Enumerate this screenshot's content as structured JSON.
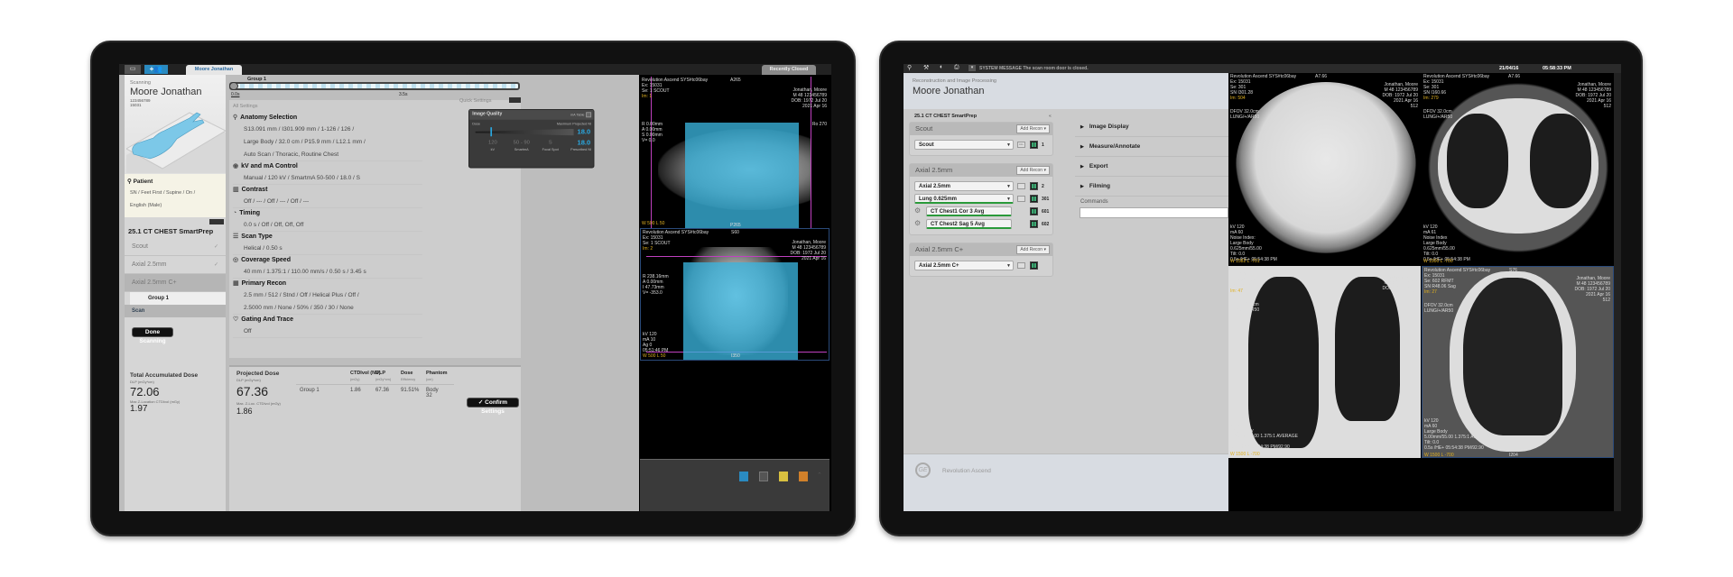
{
  "left_console": {
    "tabs": {
      "patient_tab": "Moore  Jonathan",
      "recently_closed": "Recently Closed"
    },
    "patient_panel": {
      "status": "Scanning",
      "name": "Moore  Jonathan",
      "id": "123456789",
      "exam": "15031",
      "patient_label": "Patient",
      "patient_line1": "SN / Feet First / Supine / On /",
      "patient_line2": "English (Male)"
    },
    "protocol": {
      "title": "25.1 CT CHEST SmartPrep",
      "items": [
        {
          "label": "Scout",
          "done": true
        },
        {
          "label": "Axial 2.5mm",
          "done": true
        },
        {
          "label": "Axial 2.5mm C+",
          "done": false
        }
      ],
      "group": "Group 1",
      "scan": "Scan"
    },
    "done_scanning": "Done Scanning",
    "timeline": {
      "group": "Group 1",
      "total_scan_time": "Total Scan Time: 3.5s",
      "start": "0.0s",
      "end": "3.5s"
    },
    "all_settings": {
      "title": "All Settings",
      "sections": [
        {
          "icon": "anatomy-icon",
          "title": "Anatomy Selection",
          "lines": [
            "S13.091 mm / I301.909 mm / 1-126 / 126 /",
            "Large Body / 32.0 cm / P15.9 mm / L12.1 mm /",
            "Auto Scan / Thoracic, Routine Chest"
          ]
        },
        {
          "icon": "kv-icon",
          "title": "kV and mA Control",
          "lines": [
            "Manual / 120 kV / SmartmA 50-500 / 18.0 / S"
          ]
        },
        {
          "icon": "contrast-icon",
          "title": "Contrast",
          "lines": [
            "Off / --- / Off / --- / Off / ---"
          ]
        },
        {
          "icon": "timer-icon",
          "title": "Timing",
          "lines": [
            "0.0 s / Off / Off, Off, Off"
          ]
        },
        {
          "icon": "scan-type-icon",
          "title": "Scan Type",
          "lines": [
            "Helical / 0.50 s"
          ]
        },
        {
          "icon": "speed-icon",
          "title": "Coverage Speed",
          "lines": [
            "40 mm / 1.375:1 / 110.00 mm/s / 0.50 s / 3.45 s"
          ]
        },
        {
          "icon": "recon-icon",
          "title": "Primary Recon",
          "lines": [
            "2.5 mm / 512 / Stnd / Off / Helical Plus / Off /",
            "2.5000 mm / None / 50% / 350 / 30 / None"
          ]
        },
        {
          "icon": "gating-icon",
          "title": "Gating And Trace",
          "lines": [
            "Off"
          ]
        }
      ]
    },
    "quick_settings": {
      "title": "Quick Settings",
      "image_quality": "Image Quality",
      "ma_table": "mA Table",
      "dose": "Dose",
      "max_ni_label": "Maximum Projected NI",
      "max_ni": "18.0",
      "prescribed_ni": "18.0",
      "prescribed_label": "Prescribed NI",
      "params": [
        {
          "value": "120",
          "label": "kV"
        },
        {
          "value": "50 - 90",
          "label": "SmartmA"
        },
        {
          "value": "S",
          "label": "Focal Spot"
        }
      ],
      "dose_level": 0.15
    },
    "dose": {
      "total_title": "Total Accumulated Dose",
      "total_unit": "DLP (mGy*cm)",
      "total_value": "72.06",
      "max_z_label": "Max Z-Location CTDIvol (mGy)",
      "max_z_value": "1.97",
      "projected_title": "Projected Dose",
      "projected_unit": "DLP (mGy*cm)",
      "projected_value": "67.36",
      "max_zloc_label": "Max. Z-Loc. CTDIvol (mGy)",
      "max_zloc_value": "1.86",
      "columns": [
        {
          "h": "CTDIvol (NV)",
          "u": "(mGy)"
        },
        {
          "h": "DLP",
          "u": "(mGy*cm)"
        },
        {
          "h": "Dose",
          "u": "Efficiency"
        },
        {
          "h": "Phantom",
          "u": "(cm)"
        }
      ],
      "row": {
        "group": "Group 1",
        "values": [
          "1.86",
          "67.36",
          "91.51%",
          "Body 32"
        ]
      }
    },
    "confirm_settings": "Confirm Settings",
    "viewer": {
      "top": {
        "tl": [
          "Revolution Ascend  SYS#tc06bay",
          "Ex: 15031",
          "Se: 1 SCOUT"
        ],
        "im": "Im: 1",
        "tc": "A265",
        "tr": [
          "Jonathan, Moore",
          "M 48  123456789",
          "DOB: 1972  Jul 20",
          "2021 Apr 16"
        ],
        "ml": [
          "R 0.00mm",
          "A 0.00mm",
          "S 0.00mm",
          "V= 0.0"
        ],
        "rr": "Ro 270",
        "bc": "P265",
        "wl": "W 500 L 50"
      },
      "bottom": {
        "tl": [
          "Revolution Ascend  SYS#tc06bay",
          "Ex: 15031",
          "Se: 1 SCOUT"
        ],
        "im": "Im: 2",
        "tc": "S60",
        "tr": [
          "Jonathan, Moore",
          "M 48  123456789",
          "DOB: 1972  Jul 20",
          "2021 Apr 16"
        ],
        "ml": [
          "R 238.16mm",
          "A 0.00mm",
          "I 47.73mm",
          "V= -353.0"
        ],
        "bl": [
          "kV 120",
          "mA 10",
          "Ag 0",
          "05:51:46 PM"
        ],
        "wl": "W 500 L 50",
        "bc": "I350"
      }
    }
  },
  "right_console": {
    "system_message": "SYSTEM MESSAGE  The scan room door is closed.",
    "date": "21/04/16",
    "time": "05:58:33 PM",
    "header": {
      "subtitle": "Reconstruction and Image Processing",
      "name": "Moore  Jonathan"
    },
    "protocol_title": "25.1 CT CHEST SmartPrep",
    "groups": [
      {
        "name": "Scout",
        "add": "Add Recon",
        "series": [
          {
            "label": "Scout",
            "num": "1",
            "all": "ALL"
          }
        ]
      },
      {
        "name": "Axial 2.5mm",
        "add": "Add Recon",
        "series": [
          {
            "label": "Axial 2.5mm",
            "num": "2"
          },
          {
            "label": "Lung 0.625mm",
            "num": "301"
          },
          {
            "label": "CT Chest1 Cor 3 Avg",
            "num": "601"
          },
          {
            "label": "CT Chest2 Sag 5 Avg",
            "num": "602"
          }
        ]
      },
      {
        "name": "Axial 2.5mm C+",
        "add": "Add Recon",
        "series": [
          {
            "label": "Axial 2.5mm C+",
            "num": ""
          }
        ]
      }
    ],
    "menu": [
      "Image Display",
      "Measure/Annotate",
      "Export",
      "Filming"
    ],
    "commands_label": "Commands",
    "commands_value": "",
    "brand": "Revolution Ascend",
    "images": {
      "a": {
        "tl": [
          "Revolution Ascend  SYS#tc06bay",
          "Ex: 15031",
          "Se: 301",
          "SN I301.28"
        ],
        "im": "Im: 504",
        "tc": "A7.66",
        "tr": [
          "Jonathan, Moore",
          "M 48  123456789",
          "DOB: 1972  Jul 20",
          "2021 Apr 16",
          "512"
        ],
        "dfov": [
          "DFOV 32.0cm",
          "LUNG/+/AR50"
        ],
        "bl": [
          "kV 120",
          "mA 60",
          "Noise Index:",
          "Large Body",
          "0.625mm/55.00",
          "Tilt: 0.0",
          "0.5s /HE+ 05:54:38 PM"
        ],
        "wl": "W 1582 L -701"
      },
      "b": {
        "tl": [
          "Revolution Ascend  SYS#tc06bay",
          "Ex: 15031",
          "Se: 301",
          "SN I160.66"
        ],
        "im": "Im: 279",
        "tc": "A7.66",
        "tr": [
          "Jonathan, Moore",
          "M 48  123456789",
          "DOB: 1972  Jul 20",
          "2021 Apr 16",
          "512"
        ],
        "dfov": [
          "DFOV 32.0cm",
          "LUNG/+/AR50"
        ],
        "bl": [
          "kV 120",
          "mA 61",
          "Noise Index",
          "Large Body",
          "0.625mm/55.00",
          "Tilt: 0.0",
          "0.5s /HE+ 05:54:38 PM"
        ],
        "wl": "W 1500 L -700"
      },
      "c": {
        "tl": [
          "Revolution Ascend  SYS#tc06bay",
          "Ex: 15031",
          "Se: 601 RFMT",
          "SN A46.76 Cor"
        ],
        "im": "Im: 47",
        "tc": "S76",
        "tr": [
          "Jonathan, Moore",
          "M 48  123456789",
          "DOB: 1972  Jul 20",
          "2021 Apr 16"
        ],
        "dfov": [
          "DFOV 32.0cm",
          "LUNG/+/AR50"
        ],
        "bl": [
          "kV 120",
          "mA 60",
          "Large Body",
          "3.00mm/55.00 1.375:1 AVERAGE",
          "Tilt: 0.0",
          "0.5s /HE+ 05:54:38 PM/92.90"
        ],
        "wl": "W 1500 L -700",
        "bc": "I204"
      },
      "d": {
        "tl": [
          "Revolution Ascend  SYS#tc06bay",
          "Ex: 15031",
          "Se: 602 RFMT",
          "SN R48.06 Sag"
        ],
        "im": "Im: 27",
        "tc": "S76",
        "tr": [
          "Jonathan, Moore",
          "M 48  123456789",
          "DOB: 1972  Jul 20",
          "2021 Apr 16",
          "512"
        ],
        "dfov": [
          "DFOV 32.0cm",
          "LUNG/+/AR50"
        ],
        "bl": [
          "kV 120",
          "mA 60",
          "Large Body",
          "5.00mm/55.00 1.375:1 AVERAGE",
          "Tilt: 0.0",
          "0.5s /HE+ 05:54:38 PM/92.90"
        ],
        "wl": "W 1500 L -700",
        "bc": "I204"
      }
    }
  },
  "colors": {
    "accent_blue": "#2aa8e0",
    "overlay_cyan": "#3ab4dc",
    "scanline_magenta": "#c040c0",
    "status_green": "#2a9a3a",
    "overlay_yellow": "#e0b020"
  }
}
